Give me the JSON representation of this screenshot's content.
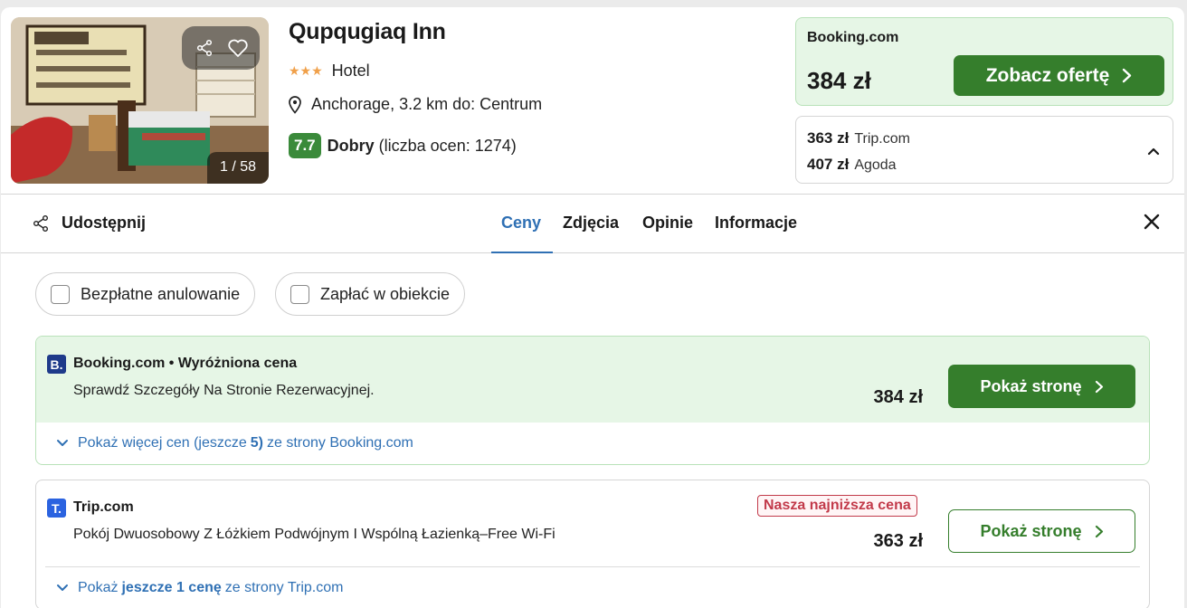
{
  "hotel": {
    "name": "Qupqugiaq Inn",
    "stars": "★★★",
    "type": "Hotel",
    "location": "Anchorage, 3.2 km do: Centrum",
    "rating_score": "7.7",
    "rating_word": "Dobry",
    "rating_count": "(liczba ocen: 1274)",
    "photo_counter": "1 / 58"
  },
  "top_offer": {
    "provider": "Booking.com",
    "price": "384 zł",
    "button": "Zobacz ofertę"
  },
  "alt_offers": [
    {
      "price": "363 zł",
      "provider": "Trip.com"
    },
    {
      "price": "407 zł",
      "provider": "Agoda"
    }
  ],
  "tabbar": {
    "share": "Udostępnij",
    "tabs": [
      "Ceny",
      "Zdjęcia",
      "Opinie",
      "Informacje"
    ],
    "active_tab": "Ceny"
  },
  "filters": [
    "Bezpłatne anulowanie",
    "Zapłać w obiekcie"
  ],
  "offers": [
    {
      "logo": "B.",
      "provider_line": "Booking.com • Wyróżniona cena",
      "description": "Sprawdź Szczegóły Na Stronie Rezerwacyjnej.",
      "price": "384 zł",
      "button": "Pokaż stronę",
      "more_prefix": "Pokaż więcej cen (jeszcze",
      "more_bold": "5)",
      "more_suffix": "ze strony Booking.com"
    },
    {
      "logo": "T.",
      "provider_line": "Trip.com",
      "badge": "Nasza najniższa cena",
      "description": "Pokój Dwuosobowy Z Łóżkiem Podwójnym I Wspólną Łazienką–Free Wi-Fi",
      "price": "363 zł",
      "button": "Pokaż stronę",
      "more_prefix": "Pokaż",
      "more_bold": "jeszcze 1 cenę",
      "more_suffix": "ze strony Trip.com"
    }
  ],
  "colors": {
    "accent_green": "#357e2c",
    "featured_bg": "#e6f6e6",
    "link_blue": "#2f70b4",
    "rating_green": "#3a8a3a",
    "star_orange": "#f0a04a",
    "lowest_red": "#c23a4a",
    "booking_blue": "#1e3a8a",
    "trip_blue": "#2b63e0"
  },
  "icons": {
    "share": "share-icon",
    "favorite": "heart-icon",
    "location": "map-pin-icon",
    "close": "close-icon",
    "collapse": "chevron-up-icon",
    "expand": "chevron-down-icon",
    "next": "chevron-right-icon"
  }
}
